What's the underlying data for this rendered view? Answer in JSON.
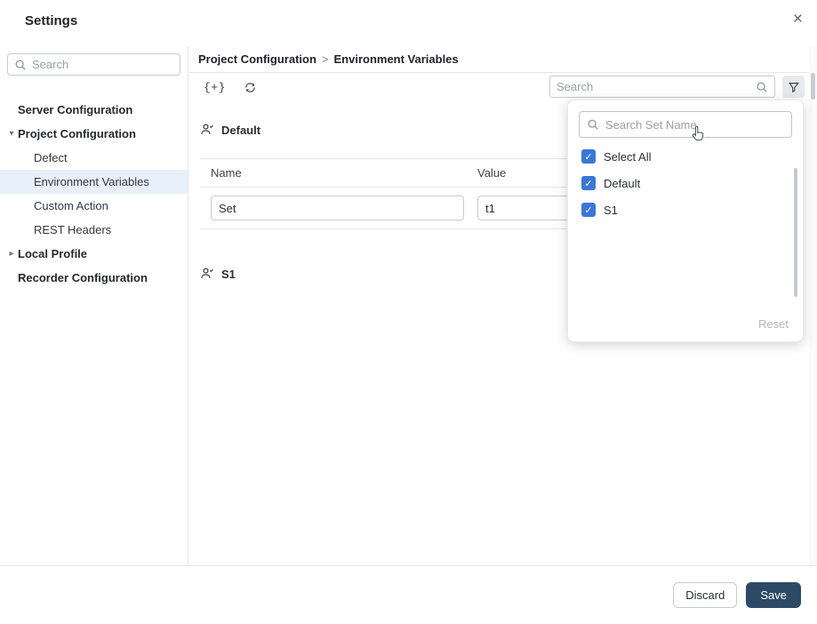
{
  "window": {
    "title": "Settings",
    "close_icon": "×"
  },
  "icons": {
    "caret_down": "▾",
    "caret_right": "▸",
    "check": "✓",
    "add_set": "{+}"
  },
  "sidebar": {
    "search_placeholder": "Search",
    "items": [
      {
        "label": "Server Configuration"
      },
      {
        "label": "Project Configuration"
      },
      {
        "label": "Defect"
      },
      {
        "label": "Environment Variables"
      },
      {
        "label": "Custom Action"
      },
      {
        "label": "REST Headers"
      },
      {
        "label": "Local Profile"
      },
      {
        "label": "Recorder Configuration"
      }
    ]
  },
  "breadcrumb": {
    "parent": "Project Configuration",
    "separator": ">",
    "current": "Environment Variables"
  },
  "toolbar": {
    "add_button": "{+}",
    "search_placeholder": "Search"
  },
  "filter_popover": {
    "search_placeholder": "Search Set Name",
    "options": [
      {
        "label": "Select All",
        "checked": true
      },
      {
        "label": "Default",
        "checked": true
      },
      {
        "label": "S1",
        "checked": true
      }
    ],
    "reset_label": "Reset"
  },
  "content": {
    "sections": [
      {
        "title": "Default",
        "table": {
          "headers": [
            "Name",
            "Value"
          ],
          "rows": [
            {
              "name": "Set",
              "value": "t1"
            }
          ]
        }
      },
      {
        "title": "S1"
      }
    ]
  },
  "footer": {
    "discard_label": "Discard",
    "save_label": "Save"
  },
  "colors": {
    "accent_blue": "#3b76d9",
    "save_button_bg": "#2c4a66",
    "selected_item_bg": "#e7f0fa"
  }
}
